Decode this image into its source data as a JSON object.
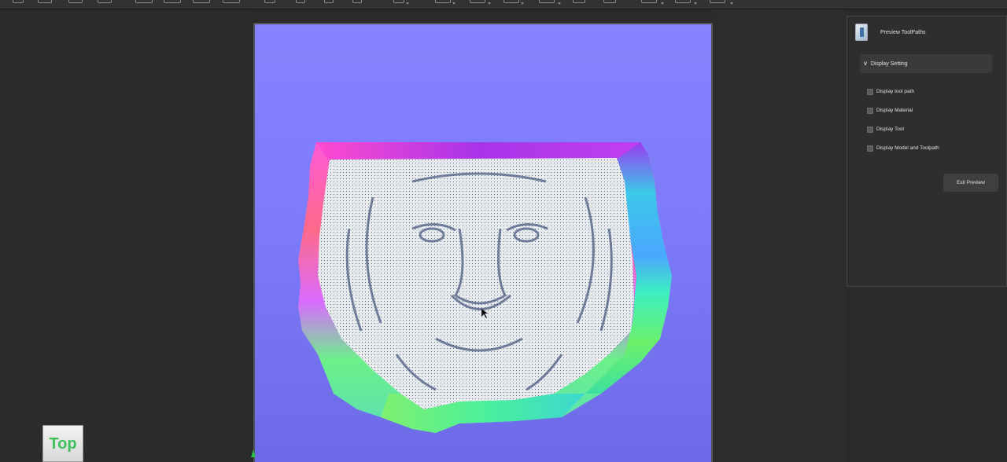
{
  "toolbar": {
    "buttons": [
      "file-new-icon",
      "open-icon",
      "save-icon",
      "import-icon",
      "view-front-icon",
      "view-back-icon",
      "view-left-icon",
      "view-right-icon",
      "select-icon",
      "move-icon",
      "rotate-icon",
      "scale-icon",
      "tool-icon",
      "toolpath-icon",
      "simulate-icon",
      "measure-icon",
      "layer-icon",
      "material-icon",
      "settings-icon",
      "export-icon",
      "help-icon",
      "window-icon"
    ]
  },
  "viewport": {
    "view_label": "Top",
    "colors": {
      "background_top": "#8583fe",
      "background_bottom": "#6c6ae6",
      "relief": "#e9ecee"
    }
  },
  "panel": {
    "title": "Preview ToolPaths",
    "section": {
      "title": "Display Setting",
      "expanded": true
    },
    "options": [
      {
        "label": "Display tool path",
        "checked": false
      },
      {
        "label": "Display Material",
        "checked": false
      },
      {
        "label": "Display Tool",
        "checked": false
      },
      {
        "label": "Display Model and Toolpath",
        "checked": false
      }
    ],
    "exit_label": "Exit Preview"
  }
}
